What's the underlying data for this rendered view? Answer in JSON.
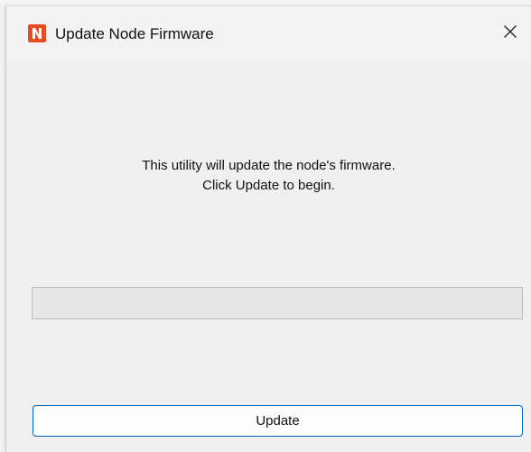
{
  "window": {
    "title": "Update Node Firmware",
    "app_icon": "node-app-icon",
    "app_icon_letter": "N",
    "close_icon": "close-icon"
  },
  "message": {
    "line1": "This utility will update the node's firmware.",
    "line2": "Click Update to begin."
  },
  "progress": {
    "value_percent": 0
  },
  "buttons": {
    "update_label": "Update"
  },
  "colors": {
    "app_icon_bg": "#ea4a1f",
    "accent_border": "#0067c0",
    "window_bg": "#f0f0f0"
  }
}
